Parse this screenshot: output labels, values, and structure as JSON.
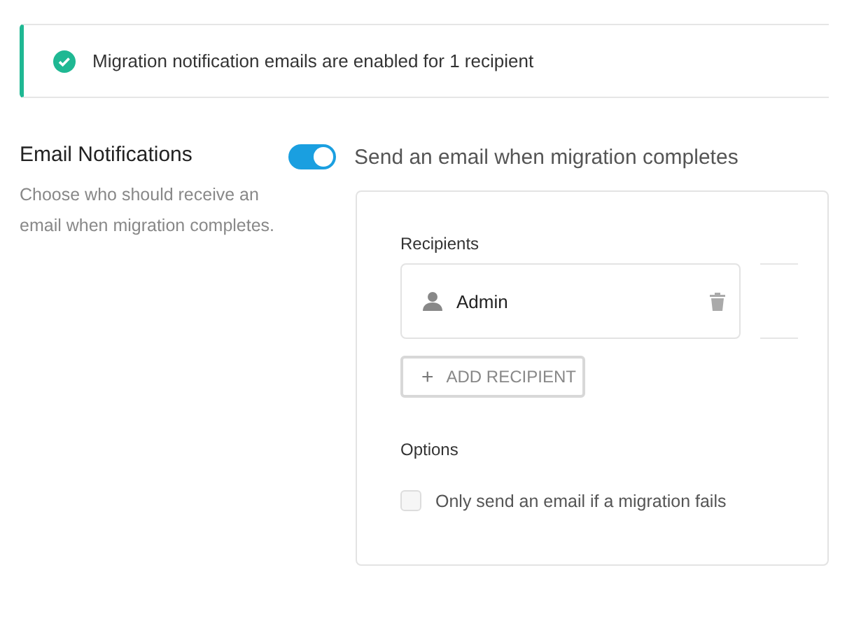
{
  "notice": {
    "text": "Migration notification emails are enabled for 1 recipient",
    "color": "#1fb893"
  },
  "section": {
    "title": "Email Notifications",
    "description": "Choose who should receive an email when migration completes."
  },
  "toggle": {
    "label": "Send an email when migration completes",
    "on": true
  },
  "recipients": {
    "label": "Recipients",
    "items": [
      {
        "name": "Admin"
      }
    ],
    "add_button": "+",
    "add_label": "ADD RECIPIENT"
  },
  "options": {
    "label": "Options",
    "items": [
      {
        "label": "Only send an email if a migration fails",
        "checked": false
      }
    ]
  }
}
